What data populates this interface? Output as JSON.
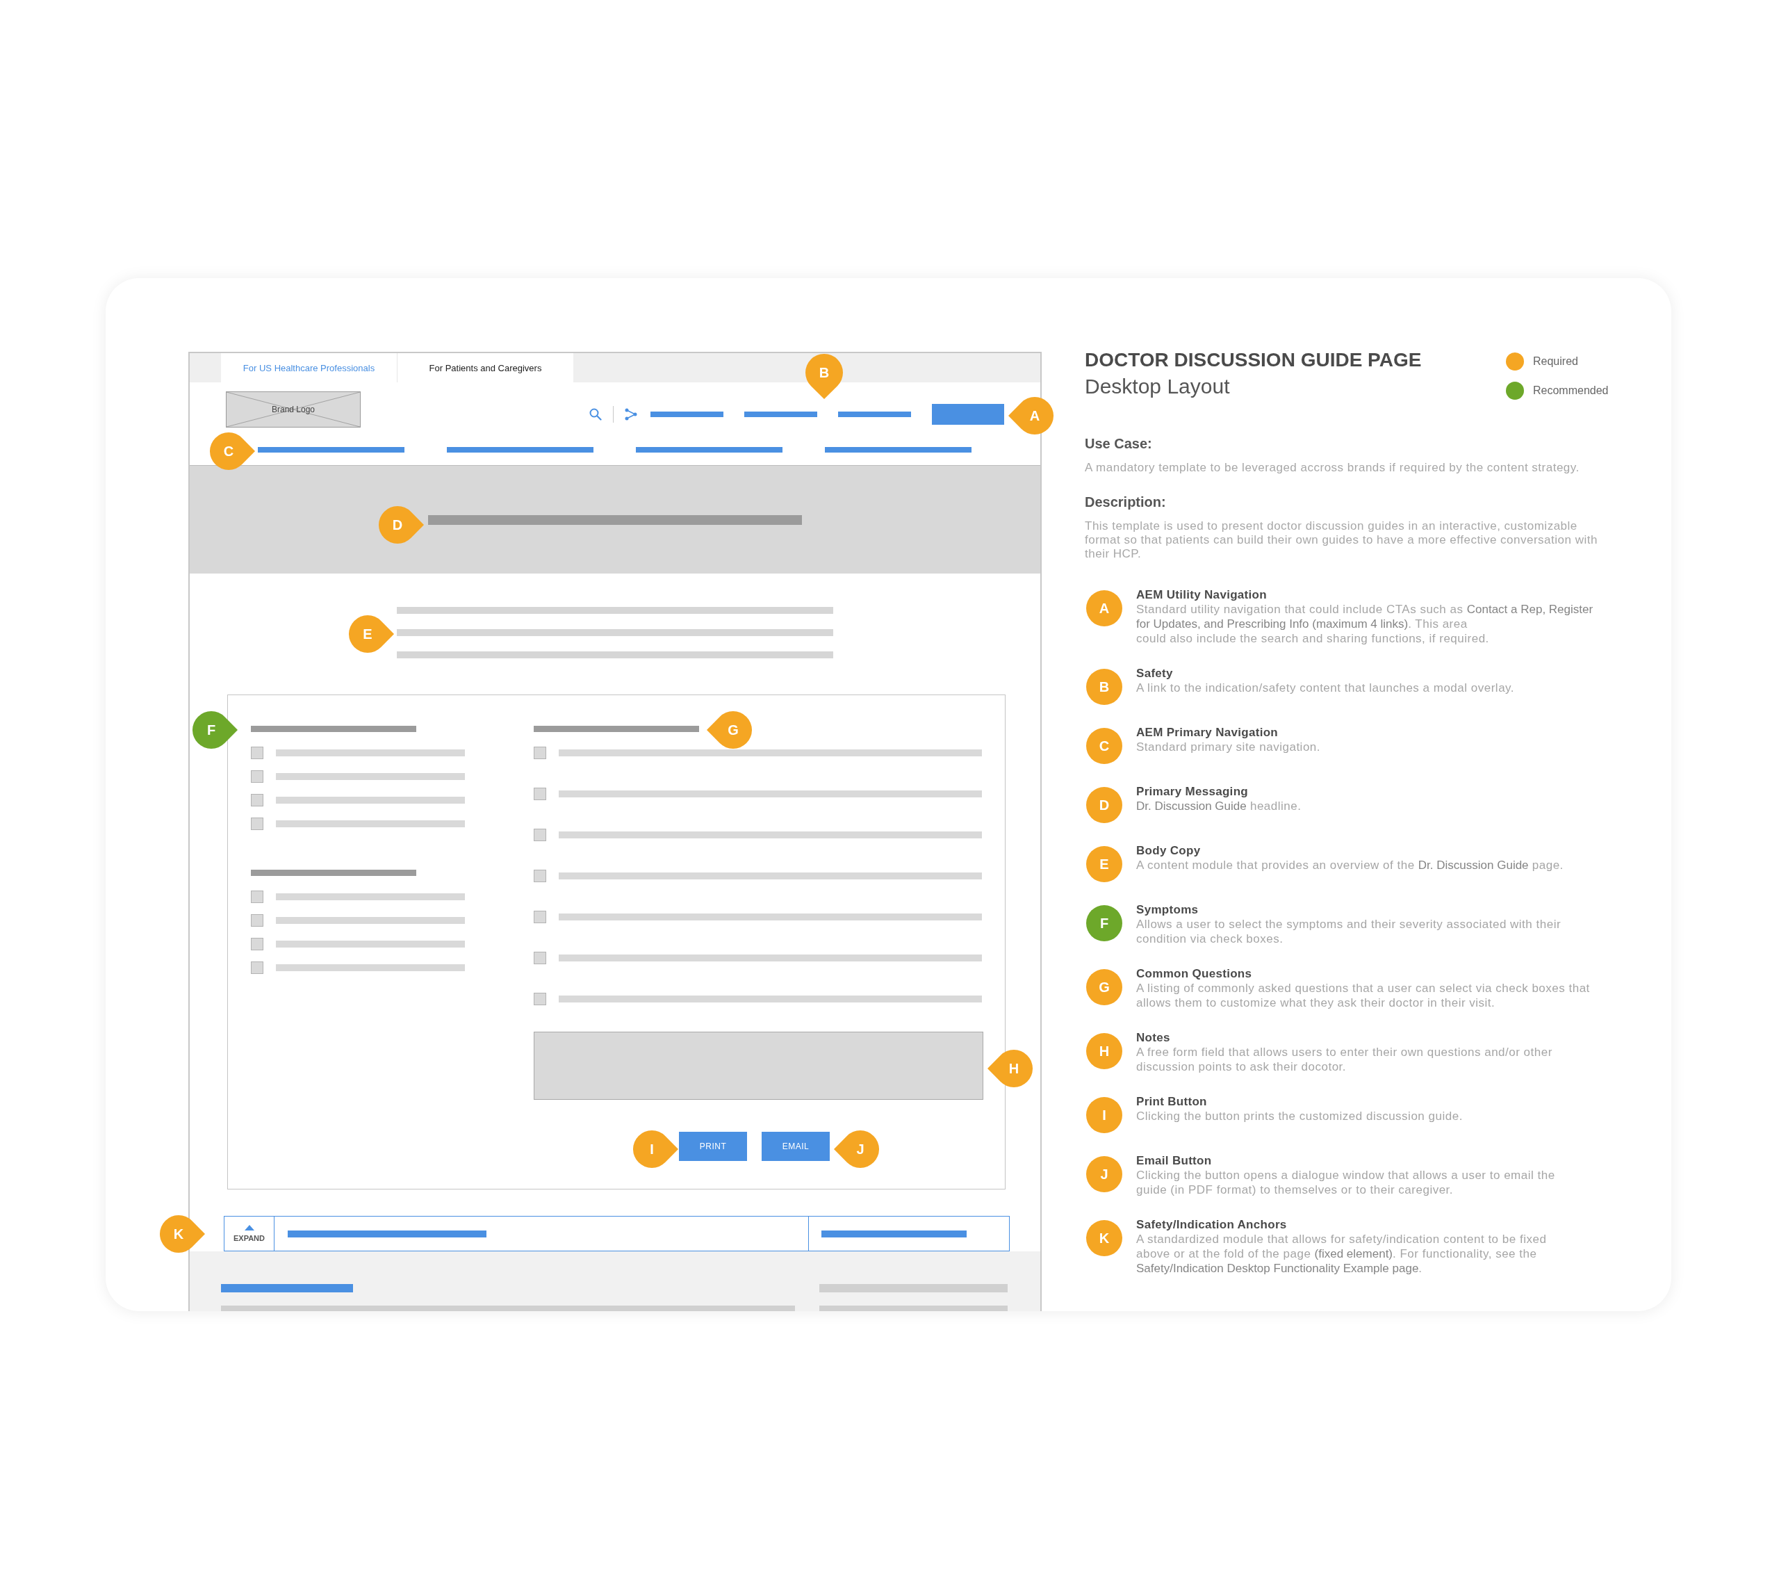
{
  "wireframe": {
    "audience_tabs": [
      {
        "label": "For US Healthcare Professionals",
        "selected": false
      },
      {
        "label": "For Patients and Caregivers",
        "selected": true
      }
    ],
    "brand_logo": "Brand Logo",
    "symptom_groups": [
      {
        "options": [
          {
            "checked": false
          },
          {
            "checked": false
          },
          {
            "checked": false
          },
          {
            "checked": false
          }
        ]
      },
      {
        "options": [
          {
            "checked": false
          },
          {
            "checked": false
          },
          {
            "checked": false
          },
          {
            "checked": false
          }
        ]
      }
    ],
    "questions": [
      {
        "checked": false
      },
      {
        "checked": false
      },
      {
        "checked": false
      },
      {
        "checked": false
      },
      {
        "checked": false
      },
      {
        "checked": false
      },
      {
        "checked": false
      }
    ],
    "buttons": [
      {
        "label": "PRINT"
      },
      {
        "label": "EMAIL"
      }
    ],
    "anchor_bar": {
      "toggle": "EXPAND",
      "expanded": false
    },
    "markers": [
      {
        "letter": "A",
        "color": "#f5a623"
      },
      {
        "letter": "B",
        "color": "#f5a623"
      },
      {
        "letter": "C",
        "color": "#f5a623"
      },
      {
        "letter": "D",
        "color": "#f5a623"
      },
      {
        "letter": "E",
        "color": "#f5a623"
      },
      {
        "letter": "F",
        "color": "#6da82a"
      },
      {
        "letter": "G",
        "color": "#f5a623"
      },
      {
        "letter": "H",
        "color": "#f5a623"
      },
      {
        "letter": "I",
        "color": "#f5a623"
      },
      {
        "letter": "J",
        "color": "#f5a623"
      },
      {
        "letter": "K",
        "color": "#f5a623"
      }
    ]
  },
  "guide": {
    "title": "DOCTOR DISCUSSION GUIDE PAGE",
    "subtitle": "Desktop Layout",
    "legend": [
      {
        "label": "Required",
        "color": "#f5a623"
      },
      {
        "label": "Recommended",
        "color": "#6da82a"
      }
    ],
    "use_case": {
      "heading": "Use Case:",
      "text": "A mandatory template to be leveraged accross brands if required by the content strategy."
    },
    "description": {
      "heading": "Description:",
      "text": "This template is used to present doctor discussion guides in an interactive, customizable format so that patients can build their own guides to have a more effective conversation with their HCP."
    },
    "annotations": [
      {
        "letter": "A",
        "color": "#f5a623",
        "title": "AEM Utility Navigation",
        "text": "Standard utility navigation that could include CTAs such as **Contact a Rep, Register**\n**for Updates, and Prescribing Info (maximum 4 links)**. This area\ncould also include the search and sharing functions, if required."
      },
      {
        "letter": "B",
        "color": "#f5a623",
        "title": "Safety",
        "text": "A link to the indication/safety content that launches a modal overlay."
      },
      {
        "letter": "C",
        "color": "#f5a623",
        "title": "AEM Primary Navigation",
        "text": "Standard primary site navigation."
      },
      {
        "letter": "D",
        "color": "#f5a623",
        "title": "Primary Messaging",
        "text": "**Dr. Discussion Guide** headline."
      },
      {
        "letter": "E",
        "color": "#f5a623",
        "title": "Body Copy",
        "text": "A content module that provides an overview of the **Dr. Discussion Guide** page."
      },
      {
        "letter": "F",
        "color": "#6da82a",
        "title": "Symptoms",
        "text": "Allows a user to select the symptoms and their severity associated with their\ncondition via check boxes."
      },
      {
        "letter": "G",
        "color": "#f5a623",
        "title": "Common Questions",
        "text": "A listing of commonly asked questions that a user can select via check boxes that\nallows them to customize what they ask their doctor in their visit."
      },
      {
        "letter": "H",
        "color": "#f5a623",
        "title": "Notes",
        "text": "A free form field that allows users to enter their own questions and/or other\ndiscussion points to ask their docotor."
      },
      {
        "letter": "I",
        "color": "#f5a623",
        "title": "Print Button",
        "text": "Clicking the button prints the customized discussion guide."
      },
      {
        "letter": "J",
        "color": "#f5a623",
        "title": "Email Button",
        "text": "Clicking the button opens a dialogue window that allows a user to email the\nguide (in PDF format) to themselves or to their caregiver."
      },
      {
        "letter": "K",
        "color": "#f5a623",
        "title": "Safety/Indication Anchors",
        "text": "A standardized module that allows for safety/indication content to be fixed\nabove or at the fold of the page **(fixed element)**. For functionality, see the\n**Safety/Indication Desktop Functionality Example page**."
      }
    ]
  }
}
